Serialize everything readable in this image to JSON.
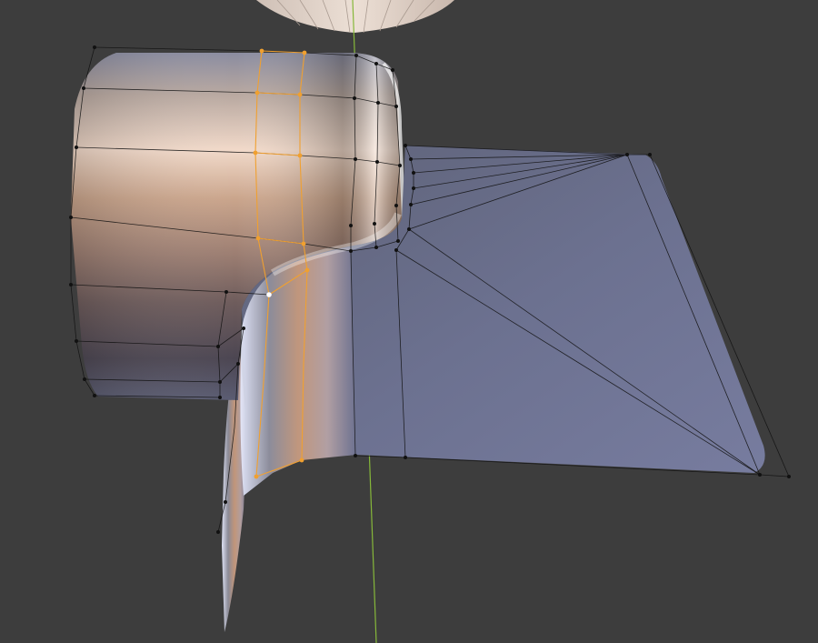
{
  "viewport": {
    "background": "#3d3d3d",
    "axis_color": "#86b83a",
    "wire_color": "#111111",
    "selected_wire_color": "#f0a030",
    "active_vertex_color": "#ffffff"
  },
  "objects": {
    "mesh": {
      "icon": "mesh-surface-icon",
      "selection": "partial"
    },
    "lamp": {
      "icon": "lamp-shade-icon"
    }
  }
}
